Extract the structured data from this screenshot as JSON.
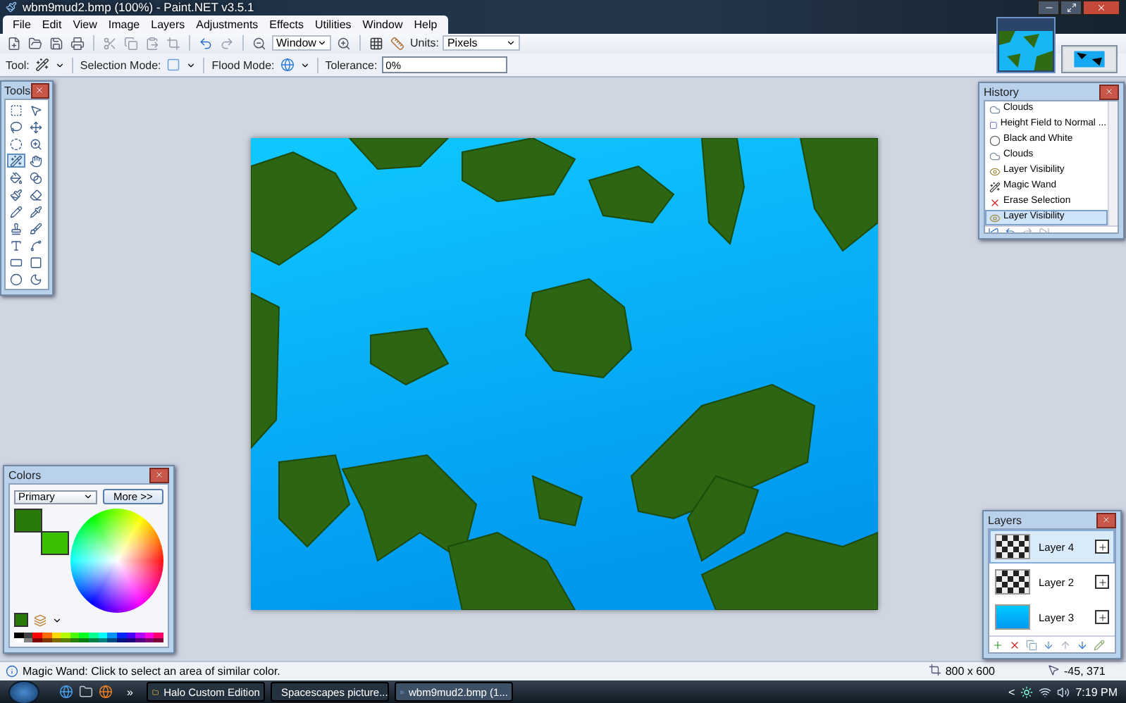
{
  "window": {
    "title": "wbm9mud2.bmp (100%) - Paint.NET v3.5.1"
  },
  "menu": [
    "File",
    "Edit",
    "View",
    "Image",
    "Layers",
    "Adjustments",
    "Effects",
    "Utilities",
    "Window",
    "Help"
  ],
  "toolbar": {
    "zoom": "Window",
    "units_label": "Units:",
    "units": "Pixels"
  },
  "tool_options": {
    "tool_label": "Tool:",
    "selection_mode_label": "Selection Mode:",
    "flood_mode_label": "Flood Mode:",
    "tolerance_label": "Tolerance:",
    "tolerance": "0%"
  },
  "open_images": [
    {
      "kind": "map",
      "selected": true
    },
    {
      "kind": "screenshot",
      "selected": false
    }
  ],
  "tools_panel": {
    "title": "Tools",
    "tools": [
      {
        "kind": "rect-select",
        "selected": false
      },
      {
        "kind": "move-selected",
        "selected": false
      },
      {
        "kind": "lasso",
        "selected": false
      },
      {
        "kind": "move-selection",
        "selected": false
      },
      {
        "kind": "ellipse-select",
        "selected": false
      },
      {
        "kind": "zoom",
        "selected": false
      },
      {
        "kind": "magic-wand",
        "selected": true
      },
      {
        "kind": "pan",
        "selected": false
      },
      {
        "kind": "paint-bucket",
        "selected": false
      },
      {
        "kind": "gradient",
        "selected": false
      },
      {
        "kind": "paintbrush",
        "selected": false
      },
      {
        "kind": "eraser",
        "selected": false
      },
      {
        "kind": "pencil",
        "selected": false
      },
      {
        "kind": "color-picker",
        "selected": false
      },
      {
        "kind": "clone-stamp",
        "selected": false
      },
      {
        "kind": "recolor",
        "selected": false
      },
      {
        "kind": "text",
        "selected": false
      },
      {
        "kind": "line",
        "selected": false
      },
      {
        "kind": "rectangle",
        "selected": false
      },
      {
        "kind": "rounded-rectangle",
        "selected": false
      },
      {
        "kind": "ellipse",
        "selected": false
      },
      {
        "kind": "freeform",
        "selected": false
      }
    ]
  },
  "history_panel": {
    "title": "History",
    "items": [
      {
        "label": "Clouds",
        "kind": "clouds",
        "selected": false
      },
      {
        "label": "Height Field to Normal ...",
        "kind": "effect",
        "selected": false
      },
      {
        "label": "Black and White",
        "kind": "adjust",
        "selected": false
      },
      {
        "label": "Clouds",
        "kind": "clouds",
        "selected": false
      },
      {
        "label": "Layer Visibility",
        "kind": "visibility",
        "selected": false
      },
      {
        "label": "Magic Wand",
        "kind": "wand",
        "selected": false
      },
      {
        "label": "Erase Selection",
        "kind": "erase",
        "selected": false
      },
      {
        "label": "Layer Visibility",
        "kind": "visibility",
        "selected": true
      }
    ]
  },
  "colors_panel": {
    "title": "Colors",
    "mode": "Primary",
    "more_button": "More >>"
  },
  "layers_panel": {
    "title": "Layers",
    "layers": [
      {
        "name": "Layer 4",
        "kind": "pattern",
        "visible": true,
        "selected": true
      },
      {
        "name": "Layer 2",
        "kind": "pattern",
        "visible": true,
        "selected": false
      },
      {
        "name": "Layer 3",
        "kind": "fill",
        "visible": true,
        "selected": false
      }
    ]
  },
  "status_bar": {
    "hint": "Magic Wand: Click to select an area of similar color.",
    "image_size": "800 x 600",
    "cursor": "-45, 371"
  },
  "taskbar": {
    "overflow": "»",
    "tasks": [
      {
        "label": "Halo Custom Edition",
        "kind": "folder",
        "selected": false
      },
      {
        "label": "Spacescapes picture...",
        "kind": "browser",
        "selected": false
      },
      {
        "label": "wbm9mud2.bmp (1...",
        "kind": "paint",
        "selected": true
      }
    ],
    "tray_chevron": "<",
    "clock": "7:19 PM"
  }
}
